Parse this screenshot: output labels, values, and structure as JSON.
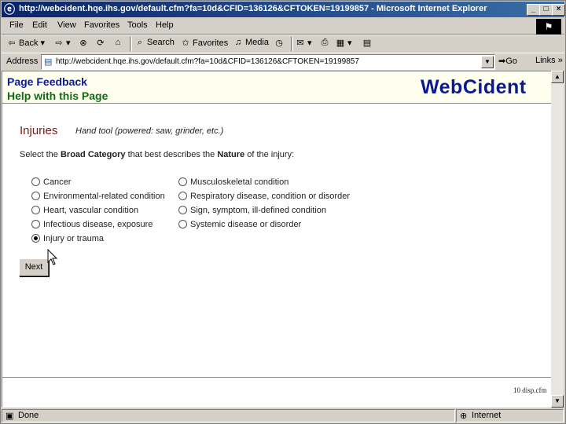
{
  "window": {
    "title": "http://webcident.hqe.ihs.gov/default.cfm?fa=10d&CFID=136126&CFTOKEN=19199857 - Microsoft Internet Explorer",
    "minimize": "_",
    "maximize": "□",
    "close": "×"
  },
  "menu": [
    "File",
    "Edit",
    "View",
    "Favorites",
    "Tools",
    "Help"
  ],
  "toolbar": {
    "back": "Back",
    "search": "Search",
    "favorites": "Favorites",
    "media": "Media"
  },
  "address": {
    "label": "Address",
    "url": "http://webcident.hqe.ihs.gov/default.cfm?fa=10d&CFID=136126&CFTOKEN=19199857",
    "go": "Go",
    "links": "Links"
  },
  "page": {
    "feedback_link": "Page Feedback",
    "help_link": "Help with this Page",
    "brand": "WebCident",
    "heading": "Injuries",
    "subheading": "Hand tool (powered: saw, grinder, etc.)",
    "instruction_pre": "Select the ",
    "instruction_bold1": "Broad Category",
    "instruction_mid": " that best describes the ",
    "instruction_bold2": "Nature",
    "instruction_post": " of the injury:",
    "options_left": [
      "Cancer",
      "Environmental-related condition",
      "Heart, vascular condition",
      "Infectious disease, exposure",
      "Injury or trauma"
    ],
    "options_right": [
      "Musculoskeletal condition",
      "Respiratory disease, condition or disorder",
      "Sign, symptom, ill-defined condition",
      "Systemic disease or disorder"
    ],
    "selected_option": "Injury or trauma",
    "next_button": "Next",
    "footer_code": "10 disp.cfm"
  },
  "status": {
    "text": "Done",
    "zone": "Internet"
  }
}
